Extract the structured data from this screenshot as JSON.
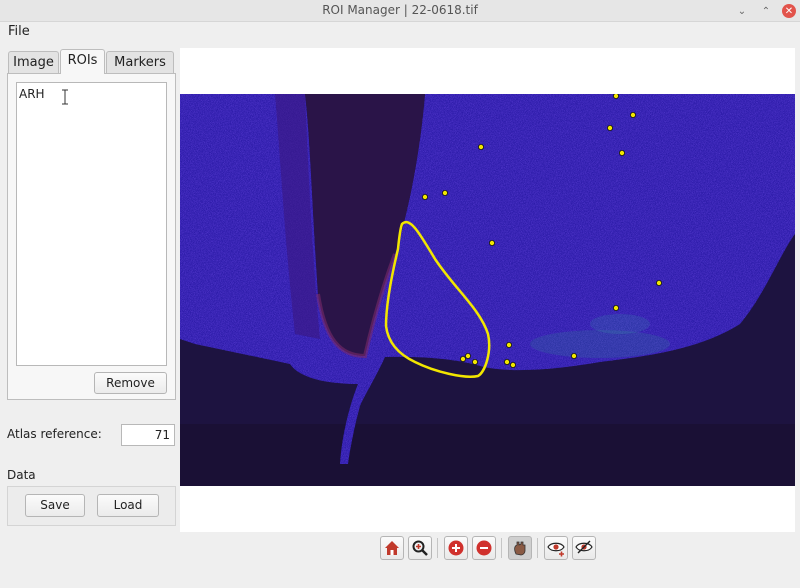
{
  "window": {
    "title": "ROI Manager   |   22-0618.tif"
  },
  "menu": {
    "file": "File"
  },
  "tabs": [
    {
      "label": "Image"
    },
    {
      "label": "ROIs"
    },
    {
      "label": "Markers"
    }
  ],
  "rois": {
    "items": [
      "ARH"
    ],
    "remove_label": "Remove"
  },
  "atlas": {
    "label": "Atlas reference:",
    "value": "71"
  },
  "data_group": {
    "label": "Data",
    "save_label": "Save",
    "load_label": "Load"
  },
  "viewer": {
    "roi_outline_color": "#f2e600",
    "marker_color": "#f2e600",
    "tissue_color": "#2a1ab0",
    "background_color": "#1e1440"
  },
  "toolbar": {
    "buttons": [
      {
        "icon": "home-icon"
      },
      {
        "icon": "zoom-to-rect-icon"
      },
      {
        "icon": "zoom-in-icon"
      },
      {
        "icon": "zoom-out-icon"
      },
      {
        "icon": "pan-icon"
      },
      {
        "icon": "show-markers-icon"
      },
      {
        "icon": "hide-markers-icon"
      }
    ]
  }
}
